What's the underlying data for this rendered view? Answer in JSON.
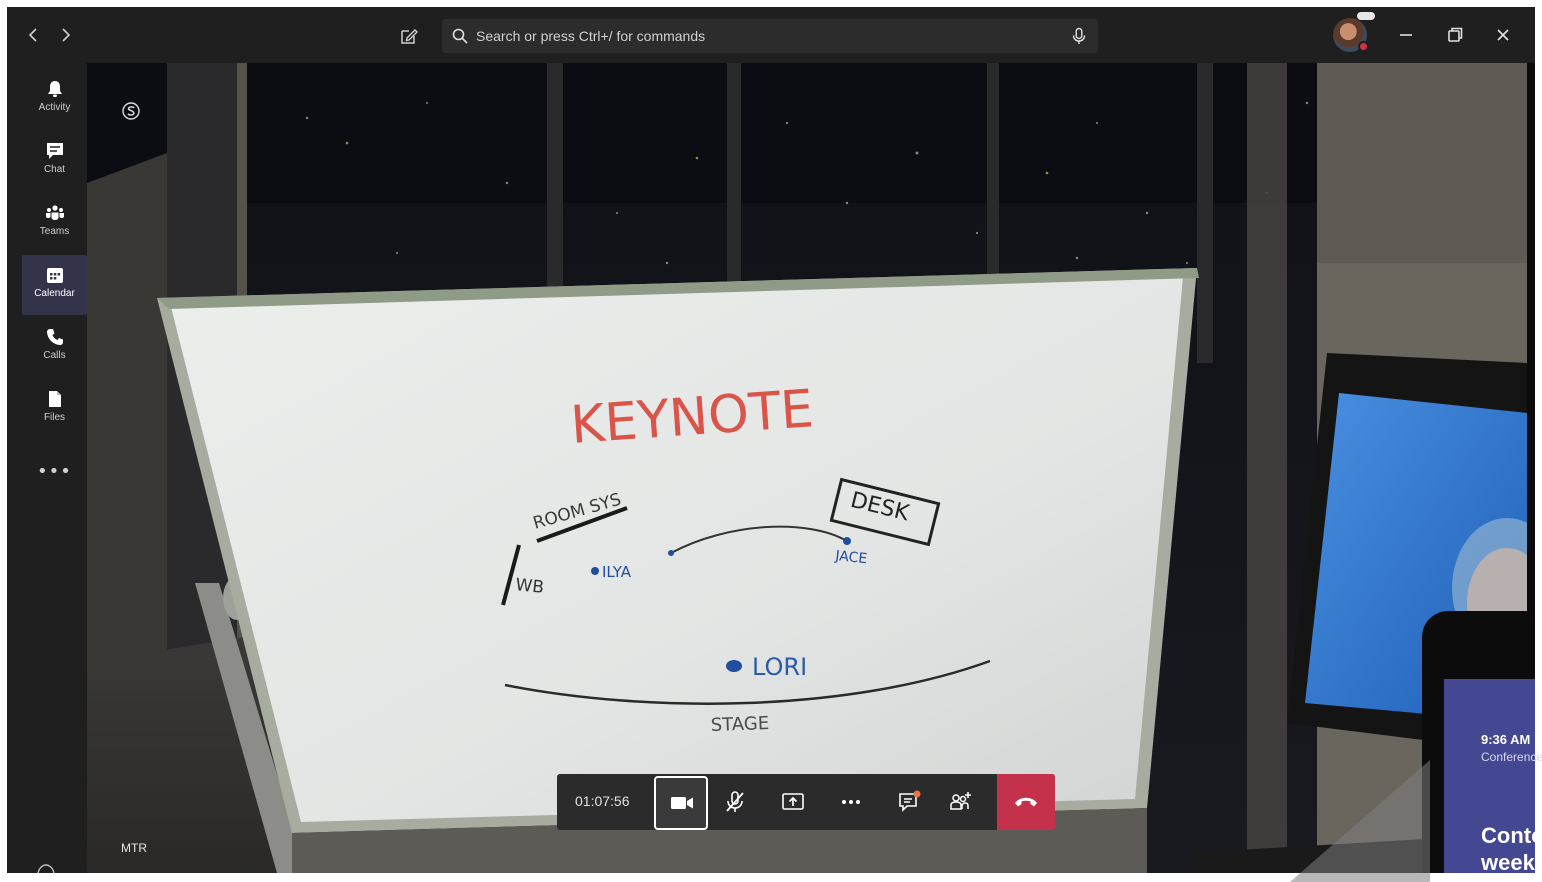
{
  "titlebar": {
    "back_icon": "chevron-left-icon",
    "forward_icon": "chevron-right-icon",
    "compose_icon": "new-chat-icon",
    "search": {
      "placeholder": "Search or press Ctrl+/ for commands"
    },
    "window_controls": [
      "minimize-icon",
      "restore-icon",
      "close-icon"
    ]
  },
  "rail": {
    "items": [
      {
        "label": "Activity",
        "icon": "bell-icon"
      },
      {
        "label": "Chat",
        "icon": "chat-icon"
      },
      {
        "label": "Teams",
        "icon": "teams-icon"
      },
      {
        "label": "Calendar",
        "icon": "calendar-icon",
        "active": true
      },
      {
        "label": "Calls",
        "icon": "phone-icon"
      },
      {
        "label": "Files",
        "icon": "file-icon"
      }
    ],
    "more": "•••"
  },
  "stage": {
    "participant_label": "MTR",
    "whiteboard": {
      "title": "KEYNOTE",
      "labels": [
        "ROOM SYS",
        "DESK",
        "WB",
        "ILYA",
        "JACE",
        "LORI",
        "STAGE"
      ]
    }
  },
  "callbar": {
    "timer": "01:07:56",
    "buttons": [
      "camera-icon",
      "mic-off-icon",
      "share-screen-icon",
      "more-icon",
      "chat-icon",
      "add-participant-icon",
      "hang-up-icon"
    ]
  },
  "phone": {
    "time": "9:36 AM",
    "subtitle": "Conference",
    "title_line1": "Conto",
    "title_line2": "weekl"
  },
  "colors": {
    "accent": "#444791",
    "hangup": "#c4314b",
    "rail_active": "#33344a",
    "whiteboard_ink_red": "#d9554a",
    "whiteboard_ink_blue": "#1f4e9e"
  }
}
